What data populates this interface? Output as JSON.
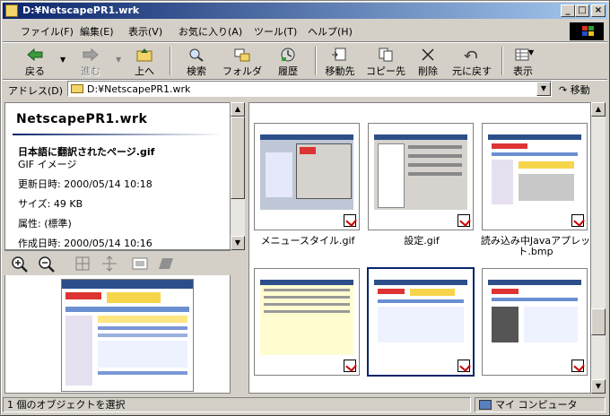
{
  "window": {
    "title": "D:¥NetscapePR1.wrk",
    "caption_minimize": "_",
    "caption_maximize": "□",
    "caption_close": "×"
  },
  "menu": [
    "ファイル(F)",
    "編集(E)",
    "表示(V)",
    "お気に入り(A)",
    "ツール(T)",
    "ヘルプ(H)"
  ],
  "toolbar": {
    "back": "戻る",
    "forward": "進む",
    "up": "上へ",
    "search": "検索",
    "folders": "フォルダ",
    "history": "履歴",
    "move_to": "移動先",
    "copy_to": "コピー先",
    "delete": "削除",
    "undo": "元に戻す",
    "views": "表示"
  },
  "address": {
    "label": "アドレス(D)",
    "value": "D:¥NetscapePR1.wrk",
    "go": "移動"
  },
  "info_pane": {
    "folder_title": "NetscapePR1.wrk",
    "file_name": "日本語に翻訳されたページ.gif",
    "file_type": "GIF イメージ",
    "modified": "更新日時: 2000/05/14 10:18",
    "size": "サイズ: 49 KB",
    "attributes": "属性: (標準)",
    "created": "作成日時: 2000/05/14 10:16"
  },
  "thumbnails": [
    {
      "label": "メニュースタイル.gif"
    },
    {
      "label": "設定.gif"
    },
    {
      "label": "読み込み中Javaアプレット.bmp"
    },
    {
      "label": ""
    },
    {
      "label": ""
    },
    {
      "label": ""
    }
  ],
  "status": {
    "left": "1 個のオブジェクトを選択",
    "zone": "マイ コンピュータ"
  },
  "colors": {
    "title_active": "#0a246a",
    "face": "#d4d0c8",
    "selection": "#0a246a"
  }
}
